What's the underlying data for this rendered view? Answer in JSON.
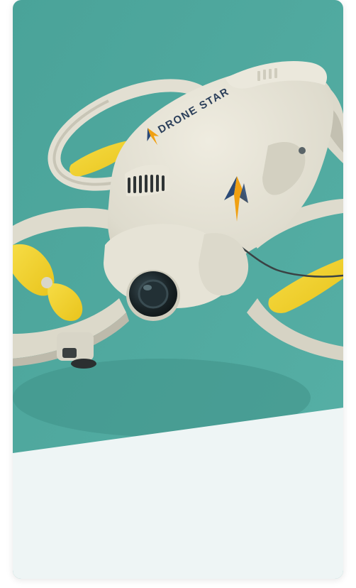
{
  "hero_image": {
    "subject": "drone",
    "brand_text": "DRONE STAR",
    "colors": {
      "background_teal": "#4ea89e",
      "background_teal_dark": "#3e8f87",
      "body": "#e4e1d4",
      "body_shadow": "#c9c6b7",
      "propeller": "#f2d12c",
      "lens": "#1f2a2e",
      "logo_orange": "#f0a012",
      "logo_navy": "#2b4a77",
      "panel": "#eef5f5"
    }
  }
}
